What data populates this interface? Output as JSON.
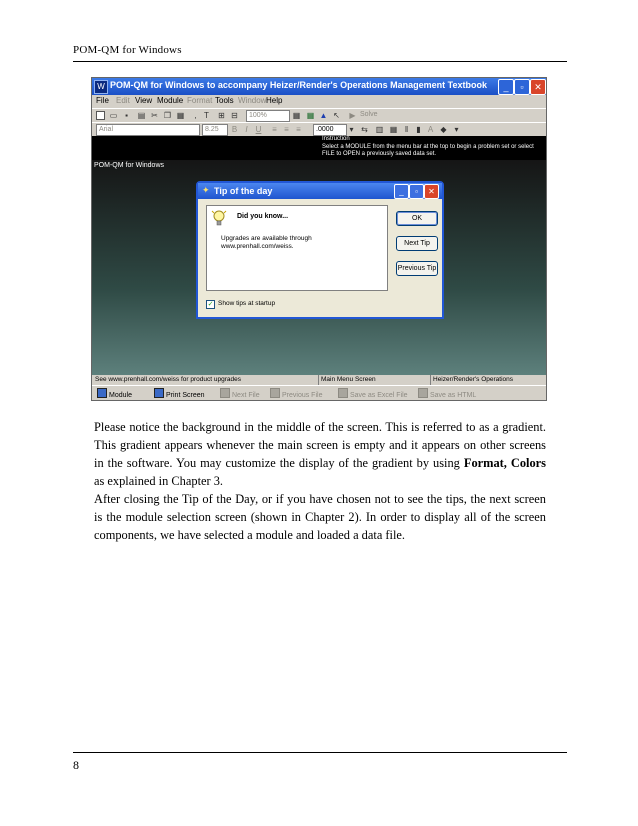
{
  "header": {
    "title": "POM-QM for Windows"
  },
  "footer": {
    "page_number": "8"
  },
  "app": {
    "title": "POM-QM for Windows to accompany Heizer/Render's Operations Management Textbook",
    "menu": [
      "File",
      "Edit",
      "View",
      "Module",
      "Format",
      "Tools",
      "Window",
      "Help"
    ],
    "toolbar": {
      "zoom": "100%",
      "solve": "Solve",
      "font": "Arial",
      "font_size": "8.25",
      "number_format": ".0000"
    },
    "instruction": {
      "heading": "Instruction",
      "text": "Select a MODULE from the menu bar at the top to begin a problem set or select FILE to OPEN a previously saved data set."
    },
    "client_label": "POM-QM for Windows",
    "status": {
      "left": "See www.prenhall.com/weiss for product upgrades",
      "middle": "Main Menu Screen",
      "right": "Heizer/Render's Operations"
    },
    "bottom_buttons": [
      "Module",
      "Print Screen",
      "Next File",
      "Previous File",
      "Save as Excel File",
      "Save as HTML"
    ]
  },
  "dialog": {
    "title": "Tip of the day",
    "heading": "Did you know...",
    "message": "Upgrades are available through www.prenhall.com/weiss.",
    "buttons": {
      "ok": "OK",
      "next": "Next Tip",
      "previous": "Previous Tip"
    },
    "checkbox_label": "Show tips at startup",
    "checkbox_checked": true
  },
  "body": {
    "p1": "Please notice the background in the middle of the screen. This is referred to as a gradient. This gradient appears whenever the main screen is empty and it appears on other screens in the software. You may customize the display of the gradient by using",
    "p1_bold": "Format, Colors",
    "p1_end": " as explained in Chapter 3.",
    "p2": "After closing the Tip of the Day, or if you have chosen not to see the tips, the next screen is the module selection screen (shown in Chapter 2). In order to display all of the screen components, we have selected a module and loaded a data file."
  }
}
